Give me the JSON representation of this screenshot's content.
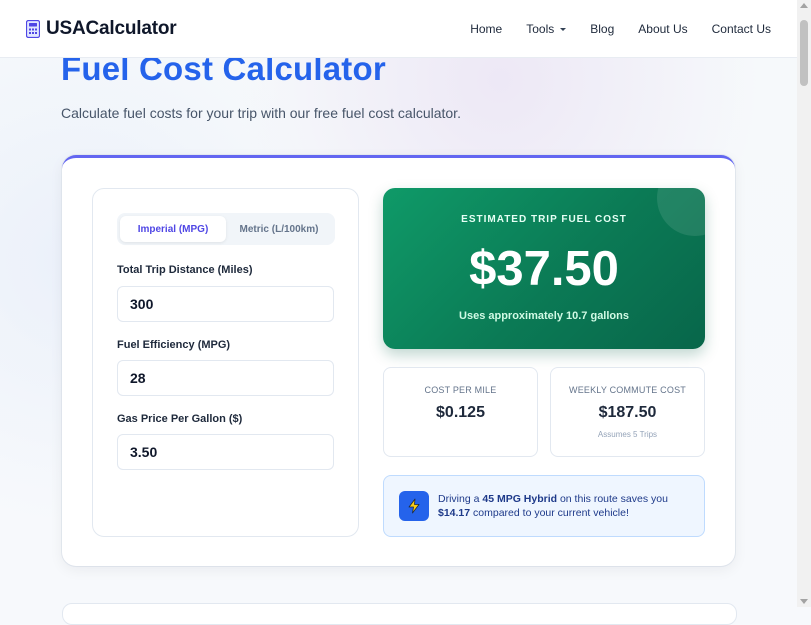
{
  "brand": {
    "name": "USACalculator"
  },
  "nav": {
    "home": "Home",
    "tools": "Tools",
    "blog": "Blog",
    "about": "About Us",
    "contact": "Contact Us"
  },
  "hero": {
    "title": "Fuel Cost Calculator",
    "subtitle": "Calculate fuel costs for your trip with our free fuel cost calculator."
  },
  "units": {
    "options": [
      "Imperial (MPG)",
      "Metric (L/100km)"
    ],
    "selected": "Imperial (MPG)"
  },
  "fields": {
    "distance": {
      "label": "Total Trip Distance (Miles)",
      "value": "300"
    },
    "efficiency": {
      "label": "Fuel Efficiency (MPG)",
      "value": "28"
    },
    "price": {
      "label": "Gas Price Per Gallon ($)",
      "value": "3.50"
    }
  },
  "result": {
    "label": "ESTIMATED TRIP FUEL COST",
    "amount": "$37.50",
    "note": "Uses approximately 10.7 gallons"
  },
  "stats": {
    "per_mile": {
      "label": "COST PER MILE",
      "value": "$0.125"
    },
    "weekly": {
      "label": "WEEKLY COMMUTE COST",
      "value": "$187.50",
      "foot": "Assumes 5 Trips"
    }
  },
  "tip": {
    "prefix": "Driving a ",
    "highlight": "45 MPG Hybrid",
    "middle": " on this route saves you ",
    "savings": "$14.17",
    "suffix": " compared to your current vehicle!"
  },
  "colors": {
    "accent": "#2563eb",
    "toggle_active": "#4f46e5",
    "result_green": "#0b7a55",
    "card_top_border": "#6366f1"
  },
  "icons": {
    "logo": "calculator-icon",
    "tip": "lightning-icon"
  }
}
